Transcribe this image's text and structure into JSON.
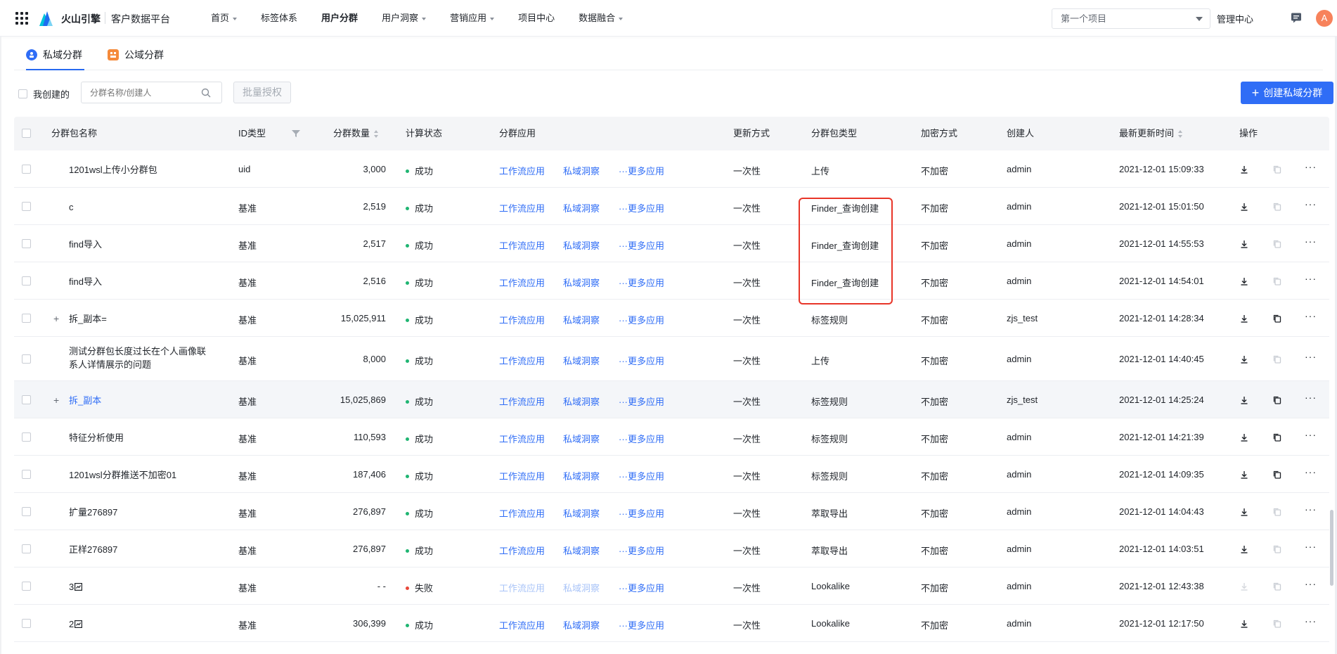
{
  "header": {
    "brand": "火山引擎",
    "product": "客户数据平台",
    "nav": [
      {
        "label": "首页",
        "caret": true
      },
      {
        "label": "标签体系",
        "caret": false
      },
      {
        "label": "用户分群",
        "caret": false,
        "active": true
      },
      {
        "label": "用户洞察",
        "caret": true
      },
      {
        "label": "营销应用",
        "caret": true
      },
      {
        "label": "项目中心",
        "caret": false
      },
      {
        "label": "数据融合",
        "caret": true
      }
    ],
    "project": "第一个项目",
    "admin": "管理中心",
    "avatar": "A"
  },
  "tabs": {
    "private": "私域分群",
    "public": "公域分群"
  },
  "filters": {
    "mine_label": "我创建的",
    "search_placeholder": "分群名称/创建人",
    "batch_label": "批量授权",
    "create_label": "创建私域分群"
  },
  "columns": {
    "name": "分群包名称",
    "id_type": "ID类型",
    "count": "分群数量",
    "status": "计算状态",
    "apps": "分群应用",
    "update": "更新方式",
    "pkg_type": "分群包类型",
    "encrypt": "加密方式",
    "creator": "创建人",
    "time": "最新更新时间",
    "ops": "操作"
  },
  "app_links": {
    "workflow": "工作流应用",
    "insight": "私域洞察",
    "more": "···更多应用"
  },
  "rows": [
    {
      "name": "1201wsl上传小分群包",
      "id_type": "uid",
      "count": "3,000",
      "status": "成功",
      "update": "一次性",
      "pkg_type": "上传",
      "encrypt": "不加密",
      "creator": "admin",
      "time": "2021-12-01 15:09:33",
      "copy_enabled": false
    },
    {
      "name": "c",
      "id_type": "基准",
      "count": "2,519",
      "status": "成功",
      "update": "一次性",
      "pkg_type": "Finder_查询创建",
      "encrypt": "不加密",
      "creator": "admin",
      "time": "2021-12-01 15:01:50",
      "copy_enabled": false
    },
    {
      "name": "find导入",
      "id_type": "基准",
      "count": "2,517",
      "status": "成功",
      "update": "一次性",
      "pkg_type": "Finder_查询创建",
      "encrypt": "不加密",
      "creator": "admin",
      "time": "2021-12-01 14:55:53",
      "copy_enabled": false
    },
    {
      "name": "find导入",
      "id_type": "基准",
      "count": "2,516",
      "status": "成功",
      "update": "一次性",
      "pkg_type": "Finder_查询创建",
      "encrypt": "不加密",
      "creator": "admin",
      "time": "2021-12-01 14:54:01",
      "copy_enabled": false
    },
    {
      "name": "拆_副本=",
      "id_type": "基准",
      "count": "15,025,911",
      "status": "成功",
      "update": "一次性",
      "pkg_type": "标签规则",
      "encrypt": "不加密",
      "creator": "zjs_test",
      "time": "2021-12-01 14:28:34",
      "copy_enabled": true,
      "expandable": true
    },
    {
      "name": "测试分群包长度过长在个人画像联系人详情展示的问题",
      "id_type": "基准",
      "count": "8,000",
      "status": "成功",
      "update": "一次性",
      "pkg_type": "上传",
      "encrypt": "不加密",
      "creator": "admin",
      "time": "2021-12-01 14:40:45",
      "copy_enabled": false,
      "tall": true
    },
    {
      "name": "拆_副本",
      "id_type": "基准",
      "count": "15,025,869",
      "status": "成功",
      "update": "一次性",
      "pkg_type": "标签规则",
      "encrypt": "不加密",
      "creator": "zjs_test",
      "time": "2021-12-01 14:25:24",
      "copy_enabled": true,
      "expandable": true,
      "hover": true
    },
    {
      "name": "特征分析使用",
      "id_type": "基准",
      "count": "110,593",
      "status": "成功",
      "update": "一次性",
      "pkg_type": "标签规则",
      "encrypt": "不加密",
      "creator": "admin",
      "time": "2021-12-01 14:21:39",
      "copy_enabled": true
    },
    {
      "name": "1201wsl分群推送不加密01",
      "id_type": "基准",
      "count": "187,406",
      "status": "成功",
      "update": "一次性",
      "pkg_type": "标签规则",
      "encrypt": "不加密",
      "creator": "admin",
      "time": "2021-12-01 14:09:35",
      "copy_enabled": true
    },
    {
      "name": "扩量276897",
      "id_type": "基准",
      "count": "276,897",
      "status": "成功",
      "update": "一次性",
      "pkg_type": "萃取导出",
      "encrypt": "不加密",
      "creator": "admin",
      "time": "2021-12-01 14:04:43",
      "copy_enabled": false
    },
    {
      "name": "正样276897",
      "id_type": "基准",
      "count": "276,897",
      "status": "成功",
      "update": "一次性",
      "pkg_type": "萃取导出",
      "encrypt": "不加密",
      "creator": "admin",
      "time": "2021-12-01 14:03:51",
      "copy_enabled": false
    },
    {
      "name": "3",
      "id_type": "基准",
      "count": "- -",
      "status": "失败",
      "update": "一次性",
      "pkg_type": "Lookalike",
      "encrypt": "不加密",
      "creator": "admin",
      "time": "2021-12-01 12:43:38",
      "copy_enabled": false,
      "failed": true,
      "badge": true
    },
    {
      "name": "2",
      "id_type": "基准",
      "count": "306,399",
      "status": "成功",
      "update": "一次性",
      "pkg_type": "Lookalike",
      "encrypt": "不加密",
      "creator": "admin",
      "time": "2021-12-01 12:17:50",
      "copy_enabled": false,
      "badge": true
    }
  ],
  "colors": {
    "primary": "#2f6df6",
    "success": "#1fb572",
    "fail": "#e8473a",
    "highlight": "#e83528",
    "avatar": "#f7825b"
  }
}
